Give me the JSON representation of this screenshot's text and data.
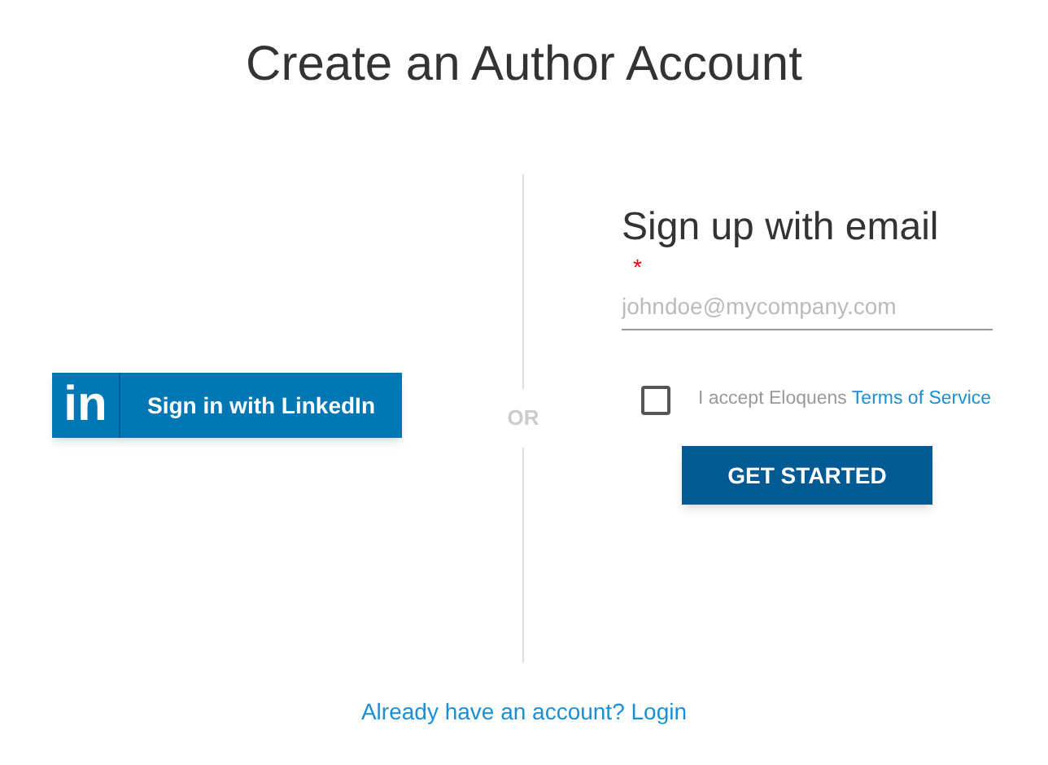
{
  "title": "Create an Author Account",
  "linkedin": {
    "logo": "in",
    "label": "Sign in with LinkedIn"
  },
  "separator": "OR",
  "email_form": {
    "heading": "Sign up with email",
    "required_mark": "*",
    "email": {
      "placeholder": "johndoe@mycompany.com"
    },
    "terms": {
      "checked": false,
      "text": "I accept Eloquens",
      "link": "Terms of Service"
    },
    "submit": "GET STARTED"
  },
  "login_link": "Already have an account? Login"
}
